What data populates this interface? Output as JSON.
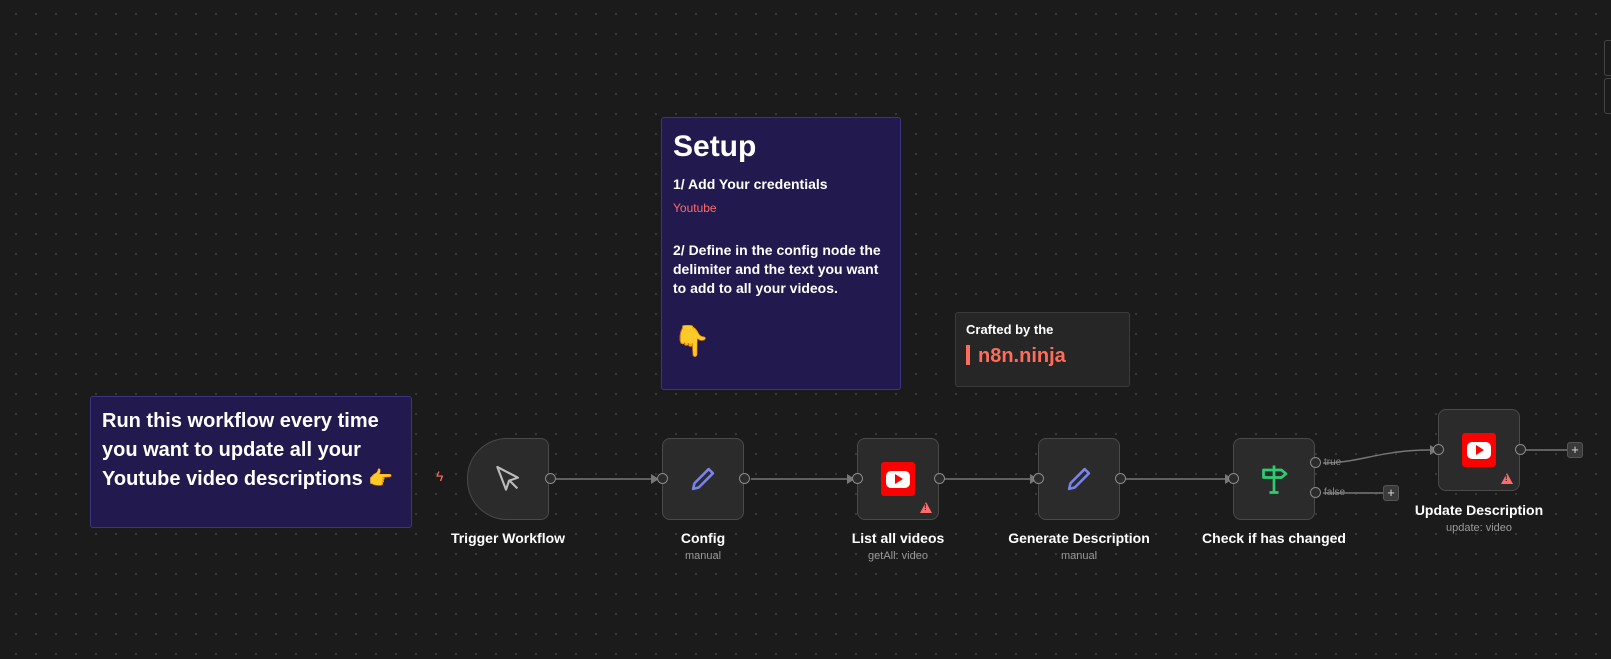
{
  "setup_note": {
    "title": "Setup",
    "step1": "1/ Add Your credentials",
    "link": "Youtube",
    "step2": "2/ Define in the config node the delimiter and the text you want to add to all your videos.",
    "emoji": "👇"
  },
  "run_note": {
    "text": "Run this workflow every time you want to update all your Youtube video descriptions 👉"
  },
  "crafted_note": {
    "line1": "Crafted by the",
    "line2": "n8n.ninja"
  },
  "nodes": {
    "trigger": {
      "label": "Trigger Workflow",
      "icon": "cursor-icon"
    },
    "config": {
      "label": "Config",
      "sub": "manual",
      "icon": "pencil-icon"
    },
    "list_videos": {
      "label": "List all videos",
      "sub": "getAll: video",
      "icon": "youtube-icon",
      "warning": true
    },
    "generate": {
      "label": "Generate Description",
      "sub": "manual",
      "icon": "pencil-icon"
    },
    "check": {
      "label": "Check if has changed",
      "icon": "signpost-icon",
      "branch_true": "true",
      "branch_false": "false"
    },
    "update": {
      "label": "Update Description",
      "sub": "update: video",
      "icon": "youtube-icon",
      "warning": true
    }
  },
  "colors": {
    "canvas": "#1b1b1b",
    "sticky": "#22194e",
    "accent": "#ff6d5a",
    "youtube": "#ff0000",
    "pencil": "#7b83eb",
    "switch": "#2ecc71"
  }
}
